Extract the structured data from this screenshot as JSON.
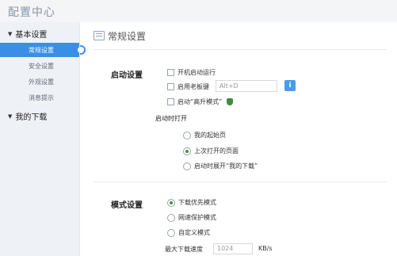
{
  "app": {
    "title": "配置中心"
  },
  "sidebar": {
    "groups": [
      {
        "label": "基本设置",
        "items": [
          {
            "label": "常规设置",
            "active": true
          },
          {
            "label": "安全设置"
          },
          {
            "label": "外观设置"
          },
          {
            "label": "消息提示"
          }
        ]
      },
      {
        "label": "我的下载"
      }
    ]
  },
  "main": {
    "section_title": "常规设置",
    "startup": {
      "label": "启动设置",
      "options": [
        {
          "label": "开机启动运行",
          "checked": false
        },
        {
          "label": "启用老板键",
          "checked": false
        },
        {
          "label": "启动“高升模式”",
          "checked": false
        }
      ],
      "hotkey_value": "Alt+D",
      "info_icon": "info-icon",
      "open_label": "启动时打开",
      "open_options": [
        {
          "label": "我的起始页",
          "selected": false
        },
        {
          "label": "上次打开的页面",
          "selected": true
        },
        {
          "label": "启动时展开“我的下载”",
          "selected": false
        }
      ]
    },
    "mode": {
      "label": "模式设置",
      "options": [
        {
          "label": "下载优先模式",
          "selected": true
        },
        {
          "label": "网速保护模式",
          "selected": false
        },
        {
          "label": "自定义模式",
          "selected": false
        }
      ],
      "max_speed_label": "最大下载速度",
      "max_speed_value": "1024",
      "max_speed_unit": "KB/s"
    }
  },
  "colors": {
    "accent": "#3a8ee6",
    "radio_on": "#2d9c3c",
    "sidebar_bg": "#eef1f5"
  }
}
